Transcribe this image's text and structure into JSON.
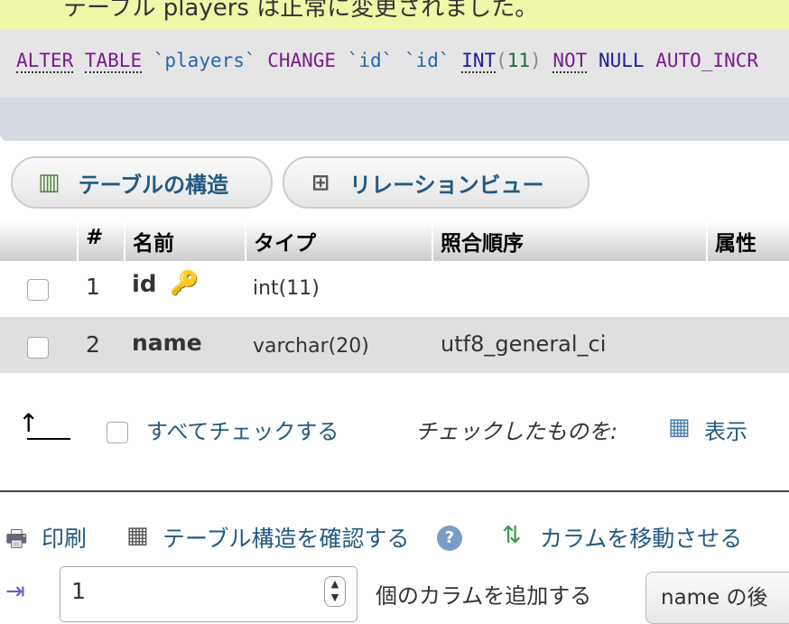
{
  "message": {
    "icon": "check-icon",
    "text": "テーブル players は正常に変更されました。"
  },
  "sql": {
    "tokens": [
      "ALTER",
      "TABLE",
      "`players`",
      "CHANGE",
      "`id`",
      "`id`",
      "INT",
      "(",
      "11",
      ")",
      "NOT",
      "NULL",
      "AUTO_INCR"
    ]
  },
  "tabs": [
    {
      "label": "テーブルの構造",
      "icon": "table-structure-icon"
    },
    {
      "label": "リレーションビュー",
      "icon": "relation-icon"
    }
  ],
  "table": {
    "headers": [
      "#",
      "名前",
      "タイプ",
      "照合順序",
      "属性"
    ],
    "rows": [
      {
        "num": "1",
        "name": "id",
        "type": "int(11)",
        "collation": "",
        "primary_key": true
      },
      {
        "num": "2",
        "name": "name",
        "type": "varchar(20)",
        "collation": "utf8_general_ci"
      }
    ]
  },
  "actions": {
    "check_all": "すべてチェックする",
    "with_selected": "チェックしたものを:",
    "browse": "表示"
  },
  "bottom": {
    "print": "印刷",
    "propose": "テーブル構造を確認する",
    "move": "カラムを移動させる",
    "add_count": "1",
    "add_label": "個のカラムを追加する",
    "position": "name の後"
  }
}
